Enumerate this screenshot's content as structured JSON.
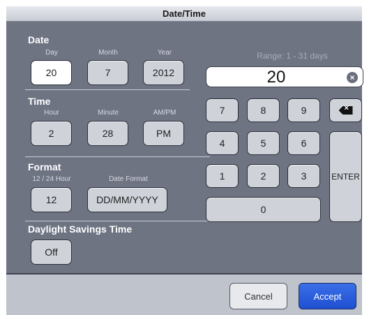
{
  "window": {
    "title": "Date/Time"
  },
  "date": {
    "title": "Date",
    "day_label": "Day",
    "month_label": "Month",
    "year_label": "Year",
    "day": "20",
    "month": "7",
    "year": "2012"
  },
  "time": {
    "title": "Time",
    "hour_label": "Hour",
    "minute_label": "Minute",
    "ampm_label": "AM/PM",
    "hour": "2",
    "minute": "28",
    "ampm": "PM"
  },
  "format": {
    "title": "Format",
    "hour_format_label": "12 / 24 Hour",
    "date_format_label": "Date Format",
    "hour_format": "12",
    "date_format": "DD/MM/YYYY"
  },
  "dst": {
    "title": "Daylight Savings Time",
    "value": "Off"
  },
  "keypad": {
    "range_label": "Range: 1 - 31 days",
    "entry_value": "20",
    "keys": {
      "k7": "7",
      "k8": "8",
      "k9": "9",
      "k4": "4",
      "k5": "5",
      "k6": "6",
      "k1": "1",
      "k2": "2",
      "k3": "3",
      "k0": "0",
      "enter": "ENTER"
    },
    "backspace_icon": "backspace-icon",
    "clear_icon": "clear-icon"
  },
  "footer": {
    "cancel": "Cancel",
    "accept": "Accept"
  },
  "colors": {
    "panel": "#6f7483",
    "accent": "#2a5ee0",
    "selected": "#ffffff"
  }
}
